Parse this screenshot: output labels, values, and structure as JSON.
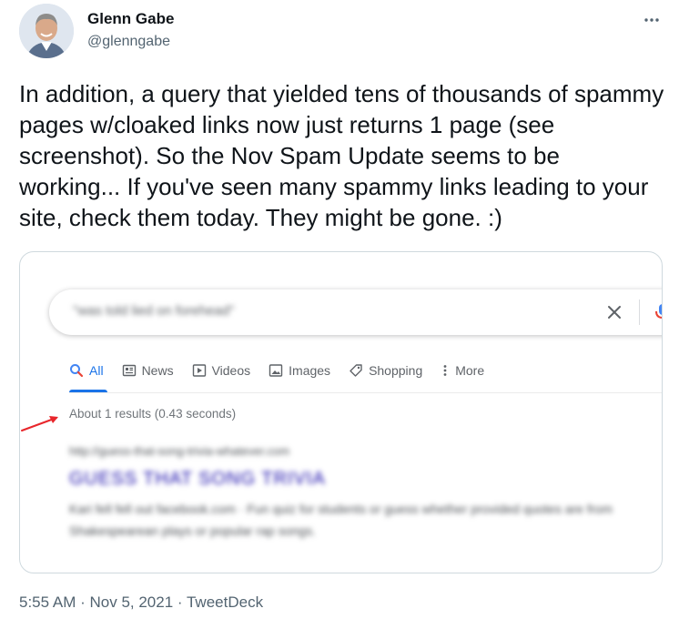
{
  "author": {
    "name": "Glenn Gabe",
    "handle": "@glenngabe"
  },
  "more_icon": "more-horizontal-icon",
  "tweet": {
    "text": "In addition, a query that yielded tens of thousands of spammy pages w/cloaked links now just returns 1 page (see screenshot). So the Nov Spam Update seems to be working... If you've seen many spammy links leading to your site, check them today. They might be gone. :)"
  },
  "screenshot": {
    "search": {
      "query": "\"was told lied on forehead\""
    },
    "tabs": [
      {
        "label": "All",
        "icon": "search-icon",
        "active": true
      },
      {
        "label": "News",
        "icon": "news-icon"
      },
      {
        "label": "Videos",
        "icon": "video-icon"
      },
      {
        "label": "Images",
        "icon": "image-icon"
      },
      {
        "label": "Shopping",
        "icon": "tag-icon"
      },
      {
        "label": "More",
        "icon": "more-vertical-icon"
      }
    ],
    "stats": "About 1 results (0.43 seconds)",
    "result": {
      "url": "http://guess-that-song-trivia-whatever.com",
      "title": "GUESS THAT SONG TRIVIA",
      "snippet": "Kari fell fell out facebook.com · Fun quiz for students or guess whether provided quotes are from Shakespearean plays or popular rap songs."
    },
    "colors": {
      "link_blue": "#1a0dab",
      "tab_active": "#1a73e8",
      "arrow_red": "#e8262b"
    }
  },
  "meta": {
    "time": "5:55 AM",
    "sep1": " · ",
    "date": "Nov 5, 2021",
    "sep2": " · ",
    "source": "TweetDeck"
  }
}
